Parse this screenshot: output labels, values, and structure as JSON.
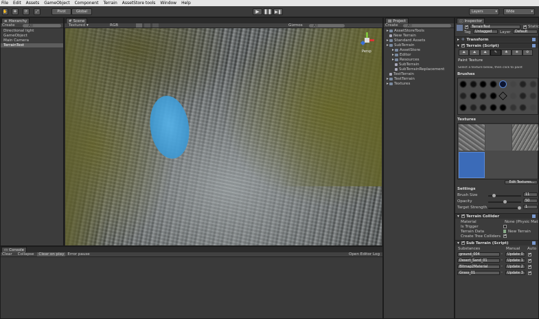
{
  "menu": [
    "File",
    "Edit",
    "Assets",
    "GameObject",
    "Component",
    "Terrain",
    "AssetStore tools",
    "Window",
    "Help"
  ],
  "toolbar": {
    "pivot": "Pivot",
    "global": "Global",
    "layers": "Layers",
    "layout": "Wide"
  },
  "hierarchy": {
    "tab": "Hierarchy",
    "create": "Create",
    "search": "All",
    "items": [
      "Directional light",
      "GameObject",
      "Main Camera",
      "TerrainTest"
    ]
  },
  "scene": {
    "tab": "Scene",
    "mode": "Textured",
    "color": "RGB",
    "gizmos": "Gizmos",
    "search": "All",
    "persp": "Persp"
  },
  "project": {
    "tab": "Project",
    "create": "Create",
    "search": "All",
    "items": [
      {
        "label": "AssetStoreTools",
        "indent": 0,
        "folder": true
      },
      {
        "label": "New Terrain",
        "indent": 0,
        "folder": false
      },
      {
        "label": "Standard Assets",
        "indent": 0,
        "folder": true
      },
      {
        "label": "SubTerrain",
        "indent": 0,
        "folder": true
      },
      {
        "label": "AssetStore",
        "indent": 1,
        "folder": true
      },
      {
        "label": "Editor",
        "indent": 1,
        "folder": true
      },
      {
        "label": "Resources",
        "indent": 1,
        "folder": true
      },
      {
        "label": "SubTerrain",
        "indent": 1,
        "folder": false
      },
      {
        "label": "SubTerrainReplacement",
        "indent": 1,
        "folder": false
      },
      {
        "label": "TestTerrain",
        "indent": 0,
        "folder": false
      },
      {
        "label": "TestTerrain",
        "indent": 0,
        "folder": true
      },
      {
        "label": "Textures",
        "indent": 0,
        "folder": true
      }
    ]
  },
  "console": {
    "tab": "Console",
    "clear": "Clear",
    "collapse": "Collapse",
    "clear_on_play": "Clear on play",
    "error_pause": "Error pause",
    "open_log": "Open Editor Log"
  },
  "inspector": {
    "tab": "Inspector",
    "object_name": "TerrainTest",
    "static": "Static",
    "tag_label": "Tag",
    "tag_value": "Untagged",
    "layer_label": "Layer",
    "layer_value": "Default",
    "transform": "Transform",
    "terrain_script": "Terrain (Script)",
    "paint_texture": "Paint Texture",
    "paint_hint": "Select a texture below, then click to paint",
    "brushes": "Brushes",
    "textures": "Textures",
    "edit_textures": "Edit Textures...",
    "settings": "Settings",
    "brush_size_label": "Brush Size",
    "brush_size": "11",
    "opacity_label": "Opacity",
    "opacity": "50",
    "target_strength_label": "Target Strength",
    "target_strength": "1",
    "collider": "Terrain Collider",
    "material_label": "Material",
    "material_value": "None (Physic Mat",
    "is_trigger": "Is Trigger",
    "terrain_data_label": "Terrain Data",
    "terrain_data_value": "New Terrain",
    "create_tree": "Create Tree Colliders",
    "subterrain": "Sub Terrain (Script)",
    "substances": "Substances",
    "manual": "Manual",
    "auto": "Auto",
    "subs": [
      {
        "name": "ground_004",
        "btn": "Update 0"
      },
      {
        "name": "Desert_Sand_01",
        "btn": "Update 1"
      },
      {
        "name": "Bitmap2Material",
        "btn": "Update 2"
      },
      {
        "name": "Grass_01",
        "btn": "Update 3"
      }
    ]
  }
}
